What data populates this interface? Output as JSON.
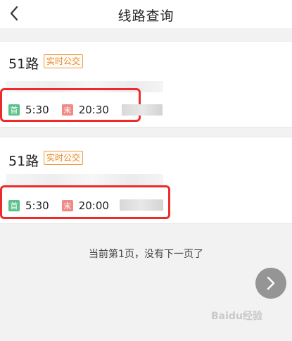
{
  "header": {
    "title": "线路查询",
    "back_icon": "chevron-left-icon"
  },
  "routes": [
    {
      "name": "51路",
      "badge": "实时公交",
      "first_label": "首",
      "first_time": "5:30",
      "last_label": "末",
      "last_time": "20:30"
    },
    {
      "name": "51路",
      "badge": "实时公交",
      "first_label": "首",
      "first_time": "5:30",
      "last_label": "末",
      "last_time": "20:00"
    }
  ],
  "pagination": {
    "status_text": "当前第1页，没有下一页了",
    "next_icon": "chevron-right-icon"
  },
  "watermark": {
    "text": "Baidu经验"
  },
  "colors": {
    "highlight": "#ee2b2b",
    "badge": "#e0892f",
    "first_tag": "#5cc28b",
    "last_tag": "#ef8a86"
  }
}
